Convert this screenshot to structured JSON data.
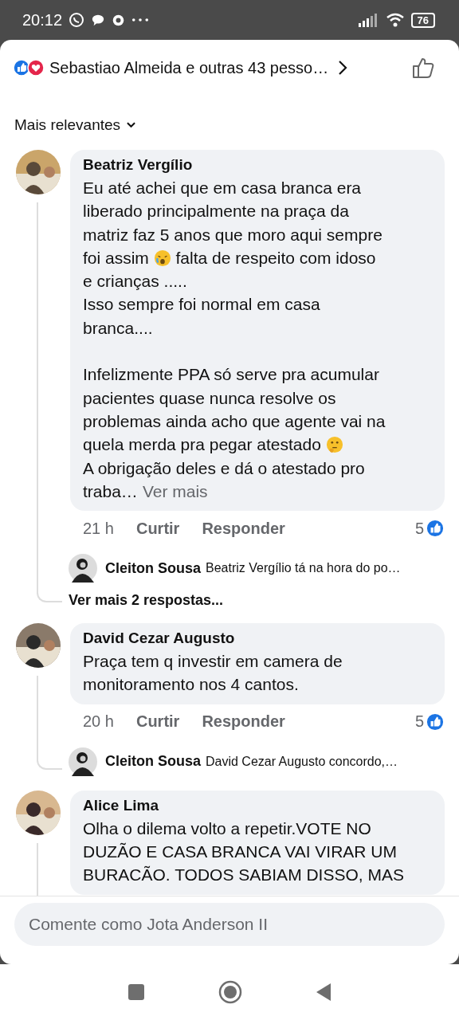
{
  "status_bar": {
    "time": "20:12",
    "battery": "76"
  },
  "reactions": {
    "summary": "Sebastiao Almeida e outras 43 pesso…"
  },
  "sort": {
    "label": "Mais relevantes"
  },
  "comments": [
    {
      "author": "Beatriz Vergílio",
      "paragraphs": [
        [
          [
            "Eu até achei que em casa branca era"
          ],
          [
            "liberado principalmente na praça da"
          ],
          [
            "matriz faz 5 anos que moro aqui sempre"
          ],
          [
            "foi assim ",
            {
              "kind": "emoji-cry"
            },
            " falta de respeito com idoso"
          ],
          [
            "e crianças ....."
          ],
          [
            "Isso sempre foi normal em casa"
          ],
          [
            "branca...."
          ]
        ],
        [
          [
            "Infelizmente PPA só serve pra acumular"
          ],
          [
            "pacientes quase nunca resolve os"
          ],
          [
            "problemas ainda acho que agente vai na"
          ],
          [
            "quela merda pra pegar atestado ",
            {
              "kind": "emoji-think"
            }
          ],
          [
            "A obrigação deles e dá o atestado pro"
          ],
          [
            "traba…",
            {
              "kind": "link",
              "text": "Ver mais"
            }
          ]
        ]
      ],
      "time": "21 h",
      "like": "Curtir",
      "reply": "Responder",
      "count": "5",
      "replies": [
        {
          "author": "Cleiton Sousa",
          "text": "Beatriz Vergílio tá na hora do po…"
        }
      ],
      "more_replies": "Ver mais 2 respostas..."
    },
    {
      "author": "David Cezar Augusto",
      "paragraphs": [
        [
          [
            "Praça tem q investir em camera de"
          ],
          [
            "monitoramento nos 4 cantos."
          ]
        ]
      ],
      "time": "20 h",
      "like": "Curtir",
      "reply": "Responder",
      "count": "5",
      "replies": [
        {
          "author": "Cleiton Sousa",
          "text": "David Cezar Augusto concordo,…"
        }
      ]
    },
    {
      "author": "Alice Lima",
      "paragraphs": [
        [
          [
            "Olha o dilema volto a repetir.VOTE NO"
          ],
          [
            "DUZÃO E CASA BRANCA VAI VIRAR UM"
          ],
          [
            "BURACÃO. TODOS SABIAM DISSO, MAS"
          ]
        ]
      ]
    }
  ],
  "composer": {
    "placeholder": "Comente como Jota Anderson II"
  }
}
